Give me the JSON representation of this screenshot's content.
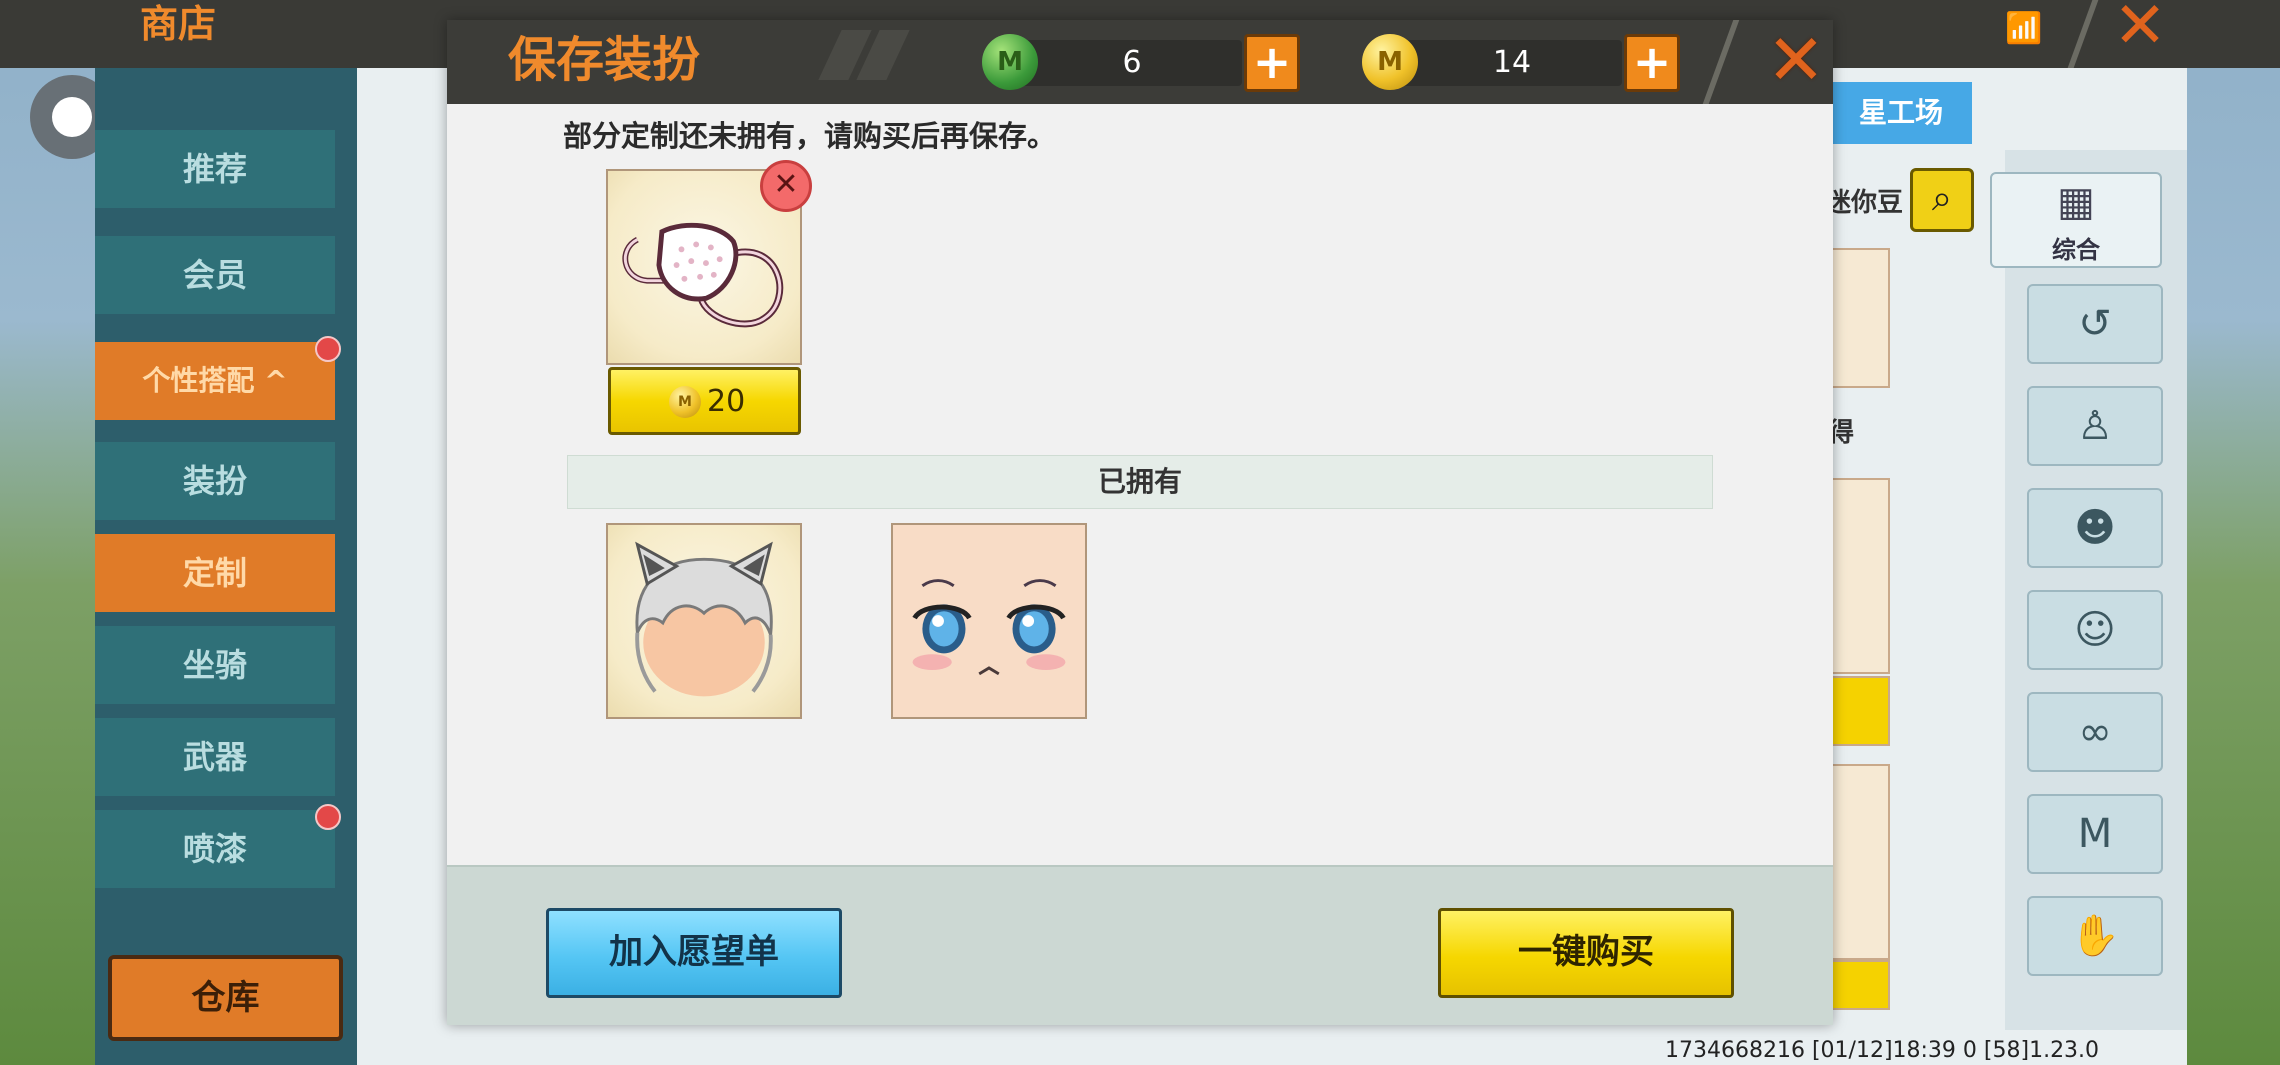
{
  "background": {
    "shop_title": "商店",
    "sidebar": [
      {
        "label": "推荐",
        "active": false,
        "dot": false
      },
      {
        "label": "会员",
        "active": false,
        "dot": false
      },
      {
        "label": "个性搭配 ^",
        "active": true,
        "dot": true
      },
      {
        "label": "装扮",
        "active": false,
        "dot": false
      },
      {
        "label": "定制",
        "active": true,
        "dot": false
      },
      {
        "label": "坐骑",
        "active": false,
        "dot": false
      },
      {
        "label": "武器",
        "active": false,
        "dot": false
      },
      {
        "label": "喷漆",
        "active": false,
        "dot": true
      }
    ],
    "warehouse_label": "仓库",
    "workshop_label": "星工场",
    "mini_bean_label": "迷你豆",
    "filter_all_label": "综合",
    "owned_label_fragment": "得",
    "status_text": "1734668216  [01/12]18:39 0  [58]1.23.0"
  },
  "modal": {
    "title": "保存装扮",
    "gems": {
      "amount": "6",
      "icon": "green-gem-icon"
    },
    "coins": {
      "amount": "14",
      "icon": "gold-coin-icon"
    },
    "notice": "部分定制还未拥有，请购买后再保存。",
    "unowned_items": [
      {
        "name": "mask",
        "price": "20",
        "currency": "coin"
      }
    ],
    "owned_section_label": "已拥有",
    "owned_items": [
      {
        "name": "hair"
      },
      {
        "name": "face"
      }
    ],
    "wishlist_label": "加入愿望单",
    "buy_all_label": "一键购买"
  },
  "colors": {
    "accent_orange": "#f08a2c",
    "button_yellow": "#f6d700",
    "button_blue": "#55c6f4",
    "header_dark": "#3c3c38"
  }
}
